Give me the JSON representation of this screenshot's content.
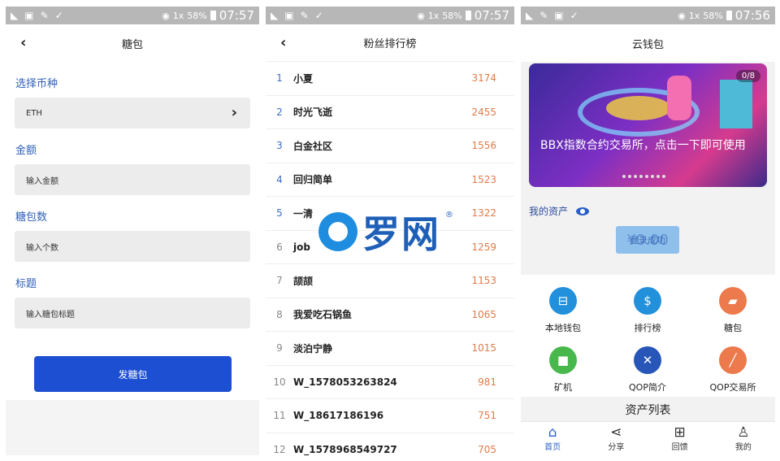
{
  "status_bars": [
    {
      "signal": "1x",
      "battery": "58%",
      "time": "07:57"
    },
    {
      "signal": "1x",
      "battery": "58%",
      "time": "07:57"
    },
    {
      "signal": "1x",
      "battery": "58%",
      "time": "07:56"
    }
  ],
  "phone1": {
    "title": "糖包",
    "currency_label": "选择币种",
    "currency_value": "ETH",
    "amount_label": "金额",
    "amount_placeholder": "输入金额",
    "count_label": "糖包数",
    "count_placeholder": "输入个数",
    "title_label": "标题",
    "title_placeholder": "输入糖包标题",
    "submit_label": "发糖包"
  },
  "phone2": {
    "title": "粉丝排行榜",
    "rows": [
      {
        "rank": "1",
        "name": "小夏",
        "score": "3174"
      },
      {
        "rank": "2",
        "name": "时光飞逝",
        "score": "2455"
      },
      {
        "rank": "3",
        "name": "白金社区",
        "score": "1556"
      },
      {
        "rank": "4",
        "name": "回归简单",
        "score": "1523"
      },
      {
        "rank": "5",
        "name": "一清",
        "score": "1322"
      },
      {
        "rank": "6",
        "name": "job",
        "score": "1259"
      },
      {
        "rank": "7",
        "name": "颉颉",
        "score": "1153"
      },
      {
        "rank": "8",
        "name": "我爱吃石锅鱼",
        "score": "1065"
      },
      {
        "rank": "9",
        "name": "淡泊宁静",
        "score": "1015"
      },
      {
        "rank": "10",
        "name": "W_1578053263824",
        "score": "981"
      },
      {
        "rank": "11",
        "name": "W_18617186196",
        "score": "751"
      },
      {
        "rank": "12",
        "name": "W_1578968549727",
        "score": "705"
      }
    ]
  },
  "watermark": {
    "text": "罗网",
    "mark": "®"
  },
  "phone3": {
    "title": "云钱包",
    "banner_counter": "0/8",
    "banner_caption": "BBX指数合约交易所，点击一下即可使用",
    "assets_label": "我的资产",
    "balance": "¥0.00",
    "balance_overlay": "登录成功",
    "grid": [
      {
        "label": "本地钱包",
        "icon": "basket-icon"
      },
      {
        "label": "排行榜",
        "icon": "dollar-icon"
      },
      {
        "label": "糖包",
        "icon": "truck-icon"
      },
      {
        "label": "矿机",
        "icon": "box-icon"
      },
      {
        "label": "QOP简介",
        "icon": "tools-icon"
      },
      {
        "label": "QOP交易所",
        "icon": "bone-icon"
      }
    ],
    "assets_list_title": "资产列表",
    "tabs": [
      {
        "label": "首页",
        "icon": "home-icon"
      },
      {
        "label": "分享",
        "icon": "share-icon"
      },
      {
        "label": "回馈",
        "icon": "gift-icon"
      },
      {
        "label": "我的",
        "icon": "user-icon"
      }
    ]
  }
}
